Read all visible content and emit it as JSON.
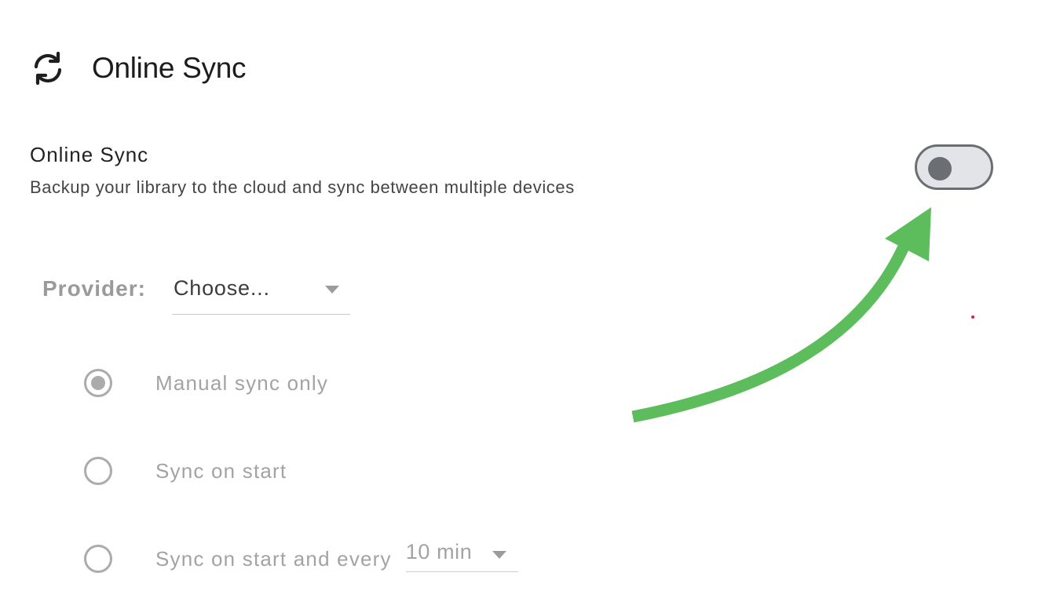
{
  "header": {
    "title": "Online Sync",
    "icon": "refresh-icon"
  },
  "setting": {
    "title": "Online Sync",
    "description": "Backup your library to the cloud and sync between multiple devices",
    "toggle_on": false
  },
  "provider": {
    "label": "Provider:",
    "selected": "Choose..."
  },
  "sync_options": [
    {
      "label": "Manual sync only",
      "checked": true
    },
    {
      "label": "Sync on start",
      "checked": false
    },
    {
      "label": "Sync on start and every",
      "checked": false
    }
  ],
  "interval": {
    "selected": "10 min"
  },
  "annotation": {
    "arrow_color": "#5dbd5d",
    "points_to": "online-sync-toggle"
  },
  "colors": {
    "toggle_border": "#6b6e73",
    "toggle_track": "#e3e4e7",
    "disabled_text": "#a3a3a3"
  }
}
